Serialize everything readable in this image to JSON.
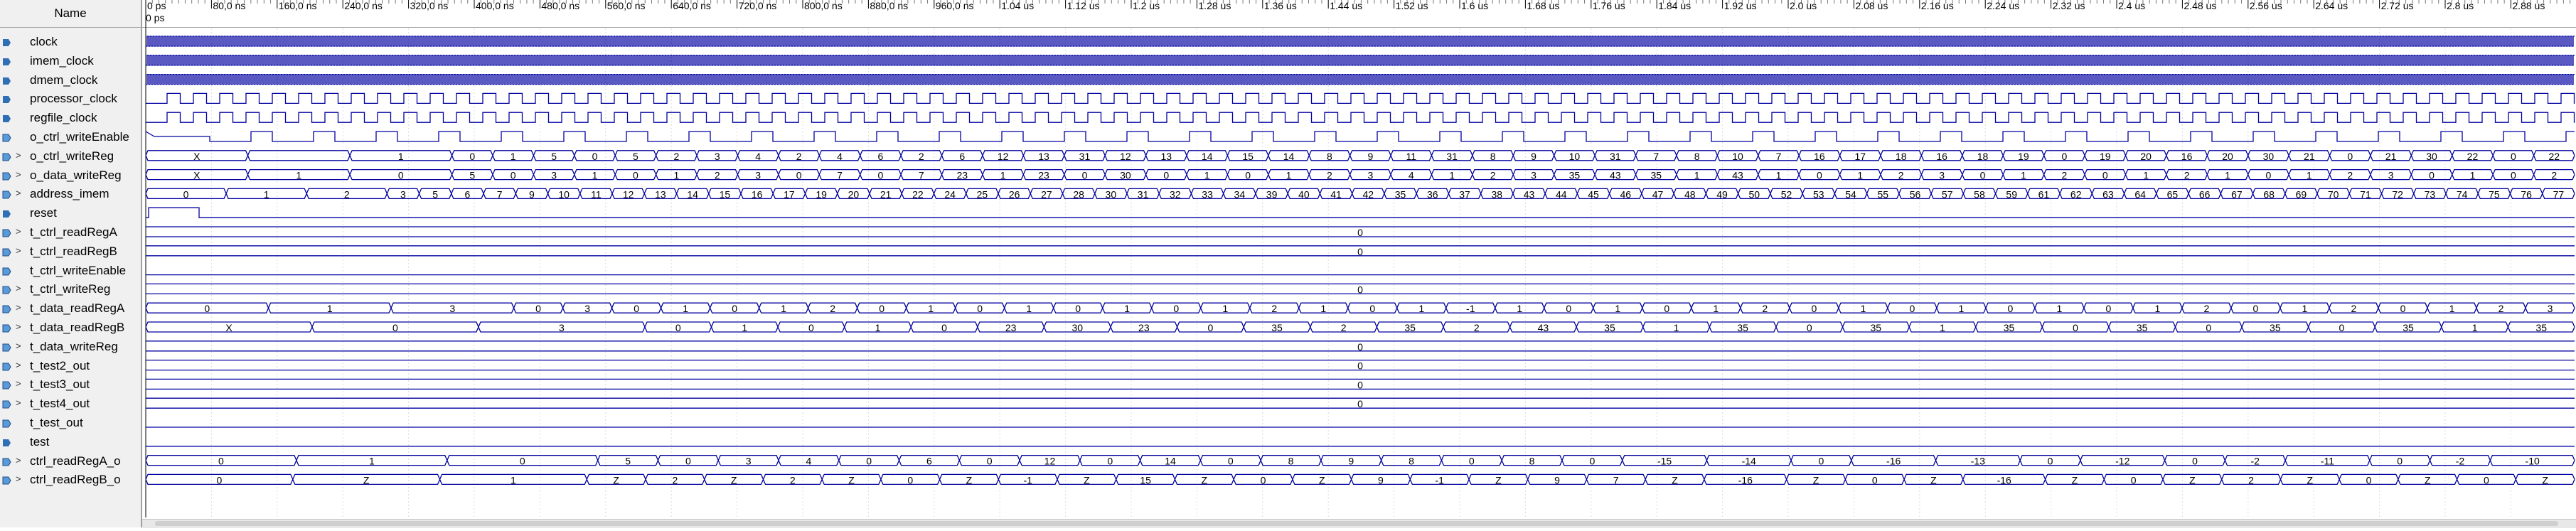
{
  "header": {
    "name_column": "Name"
  },
  "timeline": {
    "start_label": "0 ps",
    "ticks": [
      "0 ps",
      "80,0 ns",
      "160,0 ns",
      "240,0 ns",
      "320,0 ns",
      "400,0 ns",
      "480,0 ns",
      "560,0 ns",
      "640,0 ns",
      "720,0 ns",
      "800,0 ns",
      "880,0 ns",
      "960,0 ns",
      "1.04 us",
      "1.12 us",
      "1.2 us",
      "1.28 us",
      "1.36 us",
      "1.44 us",
      "1.52 us",
      "1.6 us",
      "1.68 us",
      "1.76 us",
      "1.84 us",
      "1.92 us",
      "2.0 us",
      "2.08 us",
      "2.16 us",
      "2.24 us",
      "2.32 us",
      "2.4 us",
      "2.48 us",
      "2.56 us",
      "2.64 us",
      "2.72 us",
      "2.8 us",
      "2.88 us"
    ]
  },
  "colors": {
    "wave": "#0000a0",
    "panel": "#f0f0f0",
    "grid": "#dcdcdc"
  },
  "signals": [
    {
      "name": "clock",
      "icon": "input-signal-icon",
      "kind": "clock",
      "period": 4
    },
    {
      "name": "imem_clock",
      "icon": "input-signal-icon",
      "kind": "clock",
      "period": 4
    },
    {
      "name": "dmem_clock",
      "icon": "input-signal-icon",
      "kind": "clock",
      "period": 4
    },
    {
      "name": "processor_clock",
      "icon": "input-signal-icon",
      "kind": "clock",
      "period": 20
    },
    {
      "name": "regfile_clock",
      "icon": "input-signal-icon",
      "kind": "clock",
      "period": 20
    },
    {
      "name": "o_ctrl_writeEnable",
      "icon": "output-signal-icon",
      "kind": "pulse"
    },
    {
      "name": "o_ctrl_writeReg",
      "icon": "output-signal-icon",
      "kind": "bus",
      "expandable": true,
      "values": [
        "X",
        "",
        "1",
        "0",
        "1",
        "5",
        "0",
        "5",
        "2",
        "3",
        "4",
        "2",
        "4",
        "6",
        "2",
        "6",
        "12",
        "13",
        "31",
        "12",
        "13",
        "14",
        "15",
        "14",
        "8",
        "9",
        "11",
        "31",
        "8",
        "9",
        "10",
        "31",
        "7",
        "8",
        "10",
        "7",
        "16",
        "17",
        "18",
        "16",
        "18",
        "19",
        "0",
        "19",
        "20",
        "16",
        "20",
        "30",
        "21",
        "0",
        "21",
        "30",
        "22",
        "0",
        "22"
      ]
    },
    {
      "name": "o_data_writeReg",
      "icon": "output-signal-icon",
      "kind": "bus",
      "expandable": true,
      "values": [
        "X",
        "1",
        "0",
        "5",
        "0",
        "3",
        "1",
        "0",
        "1",
        "2",
        "3",
        "0",
        "7",
        "0",
        "7",
        "23",
        "1",
        "23",
        "0",
        "30",
        "0",
        "1",
        "0",
        "1",
        "2",
        "3",
        "4",
        "1",
        "2",
        "3",
        "35",
        "43",
        "35",
        "1",
        "43",
        "1",
        "0",
        "1",
        "2",
        "3",
        "0",
        "1",
        "2",
        "0",
        "1",
        "2",
        "1",
        "0",
        "1",
        "2",
        "3",
        "0",
        "1",
        "0",
        "2"
      ]
    },
    {
      "name": "address_imem",
      "icon": "output-signal-icon",
      "kind": "bus",
      "expandable": true,
      "values": [
        "0",
        "1",
        "2",
        "3",
        "5",
        "6",
        "7",
        "9",
        "10",
        "11",
        "12",
        "13",
        "14",
        "15",
        "16",
        "17",
        "19",
        "20",
        "21",
        "22",
        "24",
        "25",
        "26",
        "27",
        "28",
        "30",
        "31",
        "32",
        "33",
        "34",
        "39",
        "40",
        "41",
        "42",
        "35",
        "36",
        "37",
        "38",
        "43",
        "44",
        "45",
        "46",
        "47",
        "48",
        "49",
        "50",
        "52",
        "53",
        "54",
        "55",
        "56",
        "57",
        "58",
        "59",
        "61",
        "62",
        "63",
        "64",
        "65",
        "66",
        "67",
        "68",
        "69",
        "70",
        "71",
        "72",
        "73",
        "74",
        "75",
        "76",
        "77"
      ]
    },
    {
      "name": "reset",
      "icon": "input-signal-icon",
      "kind": "reset"
    },
    {
      "name": "t_ctrl_readRegA",
      "icon": "output-signal-icon",
      "kind": "const",
      "expandable": true,
      "values": [
        "0"
      ]
    },
    {
      "name": "t_ctrl_readRegB",
      "icon": "output-signal-icon",
      "kind": "const",
      "expandable": true,
      "values": [
        "0"
      ]
    },
    {
      "name": "t_ctrl_writeEnable",
      "icon": "output-signal-icon",
      "kind": "low"
    },
    {
      "name": "t_ctrl_writeReg",
      "icon": "output-signal-icon",
      "kind": "const",
      "expandable": true,
      "values": [
        "0"
      ]
    },
    {
      "name": "t_data_readRegA",
      "icon": "output-signal-icon",
      "kind": "bus",
      "expandable": true,
      "values": [
        "0",
        "1",
        "3",
        "0",
        "3",
        "0",
        "1",
        "0",
        "1",
        "2",
        "0",
        "1",
        "0",
        "1",
        "0",
        "1",
        "0",
        "1",
        "2",
        "1",
        "0",
        "1",
        "-1",
        "1",
        "0",
        "1",
        "0",
        "1",
        "2",
        "0",
        "1",
        "0",
        "1",
        "0",
        "1",
        "0",
        "1",
        "2",
        "0",
        "1",
        "2",
        "0",
        "1",
        "2",
        "3"
      ]
    },
    {
      "name": "t_data_readRegB",
      "icon": "output-signal-icon",
      "kind": "bus",
      "expandable": true,
      "values": [
        "X",
        "0",
        "3",
        "0",
        "1",
        "0",
        "1",
        "0",
        "23",
        "30",
        "23",
        "0",
        "35",
        "2",
        "35",
        "2",
        "43",
        "35",
        "1",
        "35",
        "0",
        "35",
        "1",
        "35",
        "0",
        "35",
        "0",
        "35",
        "0",
        "35",
        "1",
        "35"
      ]
    },
    {
      "name": "t_data_writeReg",
      "icon": "output-signal-icon",
      "kind": "const",
      "expandable": true,
      "values": [
        "0"
      ]
    },
    {
      "name": "t_test2_out",
      "icon": "output-signal-icon",
      "kind": "const",
      "expandable": true,
      "values": [
        "0"
      ]
    },
    {
      "name": "t_test3_out",
      "icon": "output-signal-icon",
      "kind": "const",
      "expandable": true,
      "values": [
        "0"
      ]
    },
    {
      "name": "t_test4_out",
      "icon": "output-signal-icon",
      "kind": "const",
      "expandable": true,
      "values": [
        "0"
      ]
    },
    {
      "name": "t_test_out",
      "icon": "output-signal-icon",
      "kind": "low"
    },
    {
      "name": "test",
      "icon": "input-signal-icon",
      "kind": "low"
    },
    {
      "name": "ctrl_readRegA_o",
      "icon": "output-signal-icon",
      "kind": "bus",
      "expandable": true,
      "values": [
        "0",
        "1",
        "0",
        "5",
        "0",
        "3",
        "4",
        "0",
        "6",
        "0",
        "12",
        "0",
        "14",
        "0",
        "8",
        "9",
        "8",
        "0",
        "8",
        "0",
        "-15",
        "-14",
        "0",
        "-16",
        "-13",
        "0",
        "-12",
        "0",
        "-2",
        "-11",
        "0",
        "-2",
        "-10"
      ]
    },
    {
      "name": "ctrl_readRegB_o",
      "icon": "output-signal-icon",
      "kind": "bus",
      "expandable": true,
      "values": [
        "0",
        "Z",
        "1",
        "Z",
        "2",
        "Z",
        "2",
        "Z",
        "0",
        "Z",
        "-1",
        "Z",
        "15",
        "Z",
        "0",
        "Z",
        "9",
        "-1",
        "Z",
        "9",
        "7",
        "Z",
        "-16",
        "Z",
        "0",
        "Z",
        "-16",
        "Z",
        "0",
        "Z",
        "2",
        "Z",
        "0",
        "Z",
        "0",
        "Z"
      ]
    }
  ]
}
